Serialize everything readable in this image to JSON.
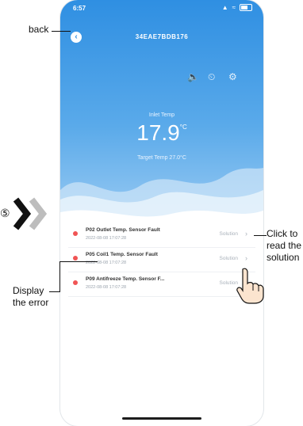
{
  "status_bar": {
    "time": "6:57",
    "signal": "▲",
    "wifi": "≈"
  },
  "header": {
    "title": "34EAE7BDB176"
  },
  "tools": {
    "volume_icon": "speaker-icon",
    "timer_icon": "clock-icon",
    "settings_icon": "gear-icon"
  },
  "temperature": {
    "inlet_label": "Inlet Temp",
    "inlet_value": "17.9",
    "inlet_unit": "°C",
    "target_label": "Target Temp",
    "target_value": "27.0°C"
  },
  "errors": [
    {
      "title": "P02 Outlet Temp. Sensor Fault",
      "time": "2022-08-08 17:07:28",
      "action": "Solution"
    },
    {
      "title": "P05 Coil1 Temp. Sensor Fault",
      "time": "2022-08-08 17:07:28",
      "action": "Solution"
    },
    {
      "title": "P09 Antifreeze Temp. Sensor F...",
      "time": "2022-08-08 17:07:28",
      "action": "Solution"
    }
  ],
  "annotations": {
    "back": "back",
    "step": "⑤",
    "click_line1": "Click to",
    "click_line2": "read the",
    "click_line3": "solution",
    "display_line1": "Display",
    "display_line2": "the error"
  },
  "colors": {
    "accent": "#2f8fe2",
    "error_dot": "#f05454"
  }
}
